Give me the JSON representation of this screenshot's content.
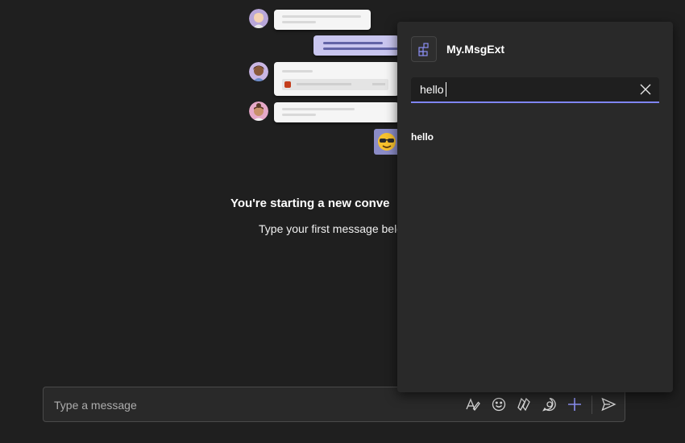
{
  "empty_state": {
    "title": "You're starting a new conve",
    "subtitle": "Type your first message belo"
  },
  "compose": {
    "placeholder": "Type a message",
    "tools": [
      {
        "name": "format-icon"
      },
      {
        "name": "emoji-icon"
      },
      {
        "name": "loop-icon"
      },
      {
        "name": "sticker-icon"
      },
      {
        "name": "plus-icon"
      },
      {
        "name": "send-icon"
      }
    ]
  },
  "flyout": {
    "app_name": "My.MsgExt",
    "app_icon": "apps-icon",
    "search": {
      "value": "hello",
      "clear_icon": "close-icon"
    },
    "results": [
      {
        "label": "hello"
      }
    ]
  },
  "colors": {
    "background": "#1f1f1f",
    "panel": "#292929",
    "accent": "#7f85f5"
  }
}
